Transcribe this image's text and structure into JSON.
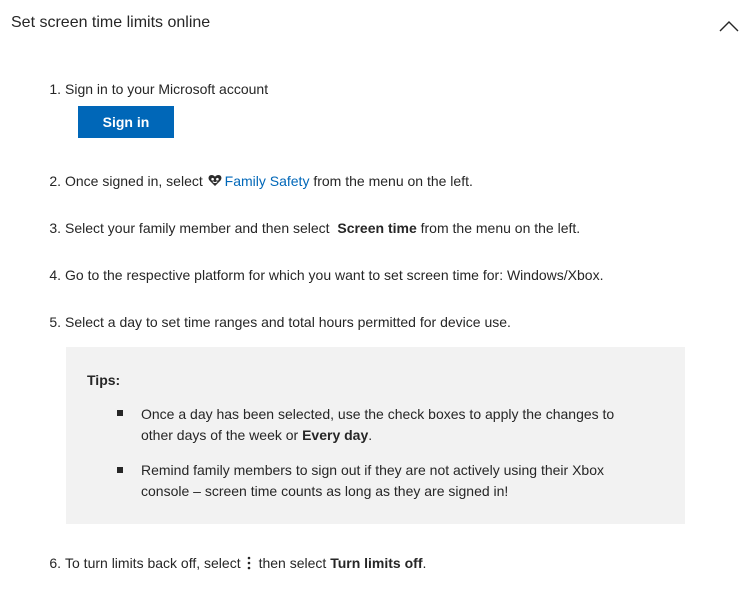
{
  "header": {
    "title": "Set screen time limits online",
    "toggle_icon": "chevron-up-icon"
  },
  "steps": [
    {
      "num": "1.",
      "text": "Sign in to your Microsoft account",
      "button_label": "Sign in"
    },
    {
      "num": "2.",
      "pre": "Once signed in, select",
      "icon": "family-heart-icon",
      "link": "Family Safety",
      "post": "from the menu on the left."
    },
    {
      "num": "3.",
      "pre": "Select your family member and then select",
      "bold": "Screen time",
      "post": "from the menu on the left."
    },
    {
      "num": "4.",
      "text": "Go to the respective platform for which you want to set screen time for: Windows/Xbox."
    },
    {
      "num": "5.",
      "text": "Select a day to set time ranges and total hours permitted for device use."
    },
    {
      "num": "6.",
      "pre": "To turn limits back off, select",
      "icon": "more-vertical-icon",
      "mid": "then select",
      "bold": "Turn limits off",
      "post": "."
    }
  ],
  "tips": {
    "label": "Tips:",
    "items": [
      {
        "pre": "Once a day has been selected, use the check boxes to apply the changes to other days of the week or ",
        "bold": "Every day",
        "post": "."
      },
      {
        "text": "Remind family members to sign out if they are not actively using their Xbox console – screen time counts as long as they are signed in!"
      }
    ]
  },
  "colors": {
    "accent": "#0067b8",
    "text": "#262626",
    "tips_bg": "#f2f2f2"
  }
}
